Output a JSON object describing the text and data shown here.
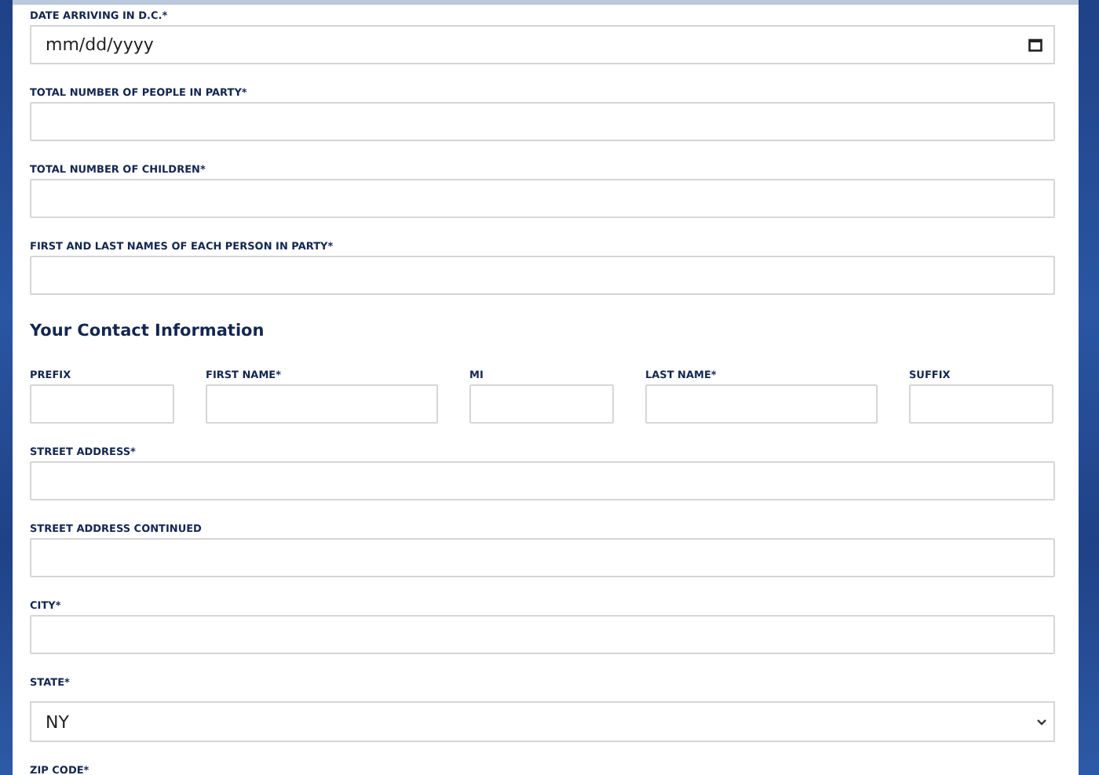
{
  "fields_top": [
    {
      "kind": "date",
      "label": "DATE ARRIVING IN D.C.*",
      "placeholder": "mm/dd/yyyy"
    },
    {
      "kind": "text",
      "label": "TOTAL NUMBER OF PEOPLE IN PARTY*"
    },
    {
      "kind": "text",
      "label": "TOTAL NUMBER OF CHILDREN*"
    },
    {
      "kind": "text",
      "label": "FIRST AND LAST NAMES OF EACH PERSON IN PARTY*"
    }
  ],
  "contact_heading": "Your Contact Information",
  "name_row": [
    {
      "label": "PREFIX"
    },
    {
      "label": "FIRST NAME*"
    },
    {
      "label": "MI"
    },
    {
      "label": "LAST NAME*"
    },
    {
      "label": "SUFFIX"
    }
  ],
  "fields_bottom": [
    {
      "kind": "text",
      "label": "STREET ADDRESS*"
    },
    {
      "kind": "text",
      "label": "STREET ADDRESS CONTINUED"
    },
    {
      "kind": "text",
      "label": "CITY*"
    },
    {
      "kind": "select",
      "label": "STATE*",
      "value": "NY"
    },
    {
      "kind": "label",
      "label": "ZIP CODE*"
    }
  ]
}
